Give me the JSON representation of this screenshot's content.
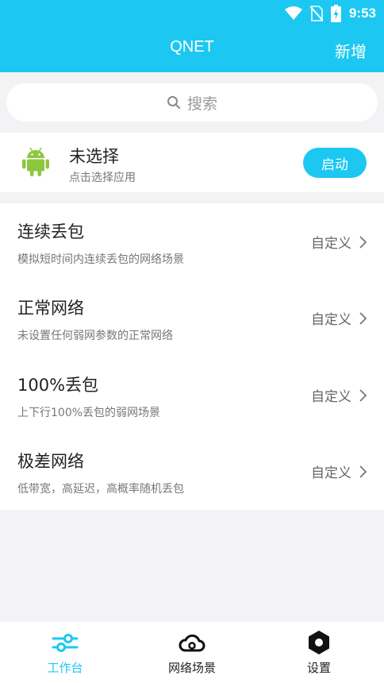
{
  "status_bar": {
    "time": "9:53"
  },
  "app_bar": {
    "title": "QNET",
    "action_label": "新增"
  },
  "search": {
    "placeholder": "搜索"
  },
  "selected_app": {
    "name": "未选择",
    "hint": "点击选择应用",
    "start_label": "启动"
  },
  "scenes": [
    {
      "title": "连续丢包",
      "desc": "模拟短时间内连续丢包的网络场景",
      "action": "自定义"
    },
    {
      "title": "正常网络",
      "desc": "未设置任何弱网参数的正常网络",
      "action": "自定义"
    },
    {
      "title": "100%丢包",
      "desc": "上下行100%丢包的弱网场景",
      "action": "自定义"
    },
    {
      "title": "极差网络",
      "desc": "低带宽，高延迟，高概率随机丢包",
      "action": "自定义"
    }
  ],
  "bottom_nav": {
    "tabs": [
      {
        "label": "工作台",
        "icon": "sliders-icon",
        "active": true
      },
      {
        "label": "网络场景",
        "icon": "cloud-icon",
        "active": false
      },
      {
        "label": "设置",
        "icon": "settings-hex-icon",
        "active": false
      }
    ]
  },
  "colors": {
    "accent": "#1cc8f1",
    "android_green": "#8dc63f",
    "background": "#f3f3f5"
  }
}
